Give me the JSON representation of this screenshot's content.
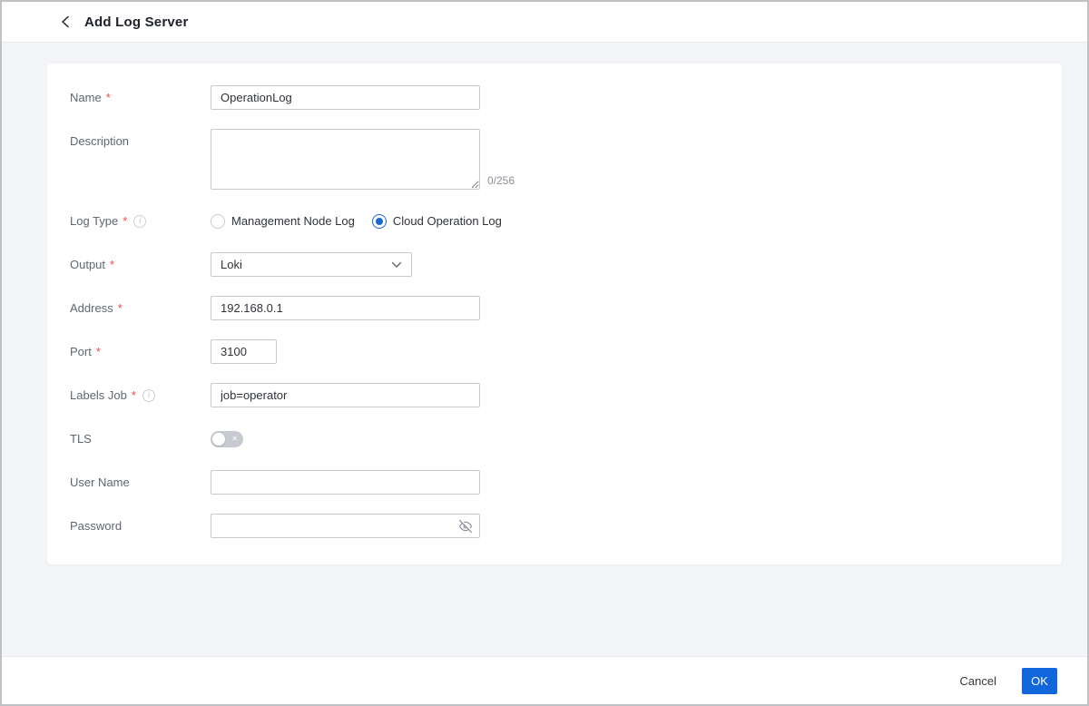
{
  "header": {
    "title": "Add Log Server"
  },
  "marks": {
    "required": "*",
    "info_icon": "i",
    "toggle_off_mark": "✕"
  },
  "form": {
    "name": {
      "label": "Name",
      "required": true,
      "value": "OperationLog"
    },
    "description": {
      "label": "Description",
      "value": "",
      "counter": "0/256"
    },
    "log_type": {
      "label": "Log Type",
      "required": true,
      "has_info_icon": true,
      "options": [
        {
          "label": "Management Node Log",
          "selected": false
        },
        {
          "label": "Cloud Operation Log",
          "selected": true
        }
      ]
    },
    "output": {
      "label": "Output",
      "required": true,
      "selected_value": "Loki"
    },
    "address": {
      "label": "Address",
      "required": true,
      "value": "192.168.0.1"
    },
    "port": {
      "label": "Port",
      "required": true,
      "value": "3100"
    },
    "labels_job": {
      "label": "Labels Job",
      "required": true,
      "has_info_icon": true,
      "value": "job=operator"
    },
    "tls": {
      "label": "TLS",
      "enabled": false
    },
    "user_name": {
      "label": "User Name",
      "value": "",
      "placeholder": ""
    },
    "password": {
      "label": "Password",
      "value": "",
      "placeholder": ""
    }
  },
  "footer": {
    "cancel_label": "Cancel",
    "ok_label": "OK"
  },
  "colors": {
    "primary_blue": "#1266dc",
    "radio_selected_blue": "#1e66d0",
    "required_asterisk_red": "#f5483b",
    "page_background": "#f3f5f8",
    "card_background": "#ffffff",
    "input_border": "#c6c9cf",
    "label_gray": "#5f666e",
    "toggle_off_gray": "#c7cbd1"
  }
}
